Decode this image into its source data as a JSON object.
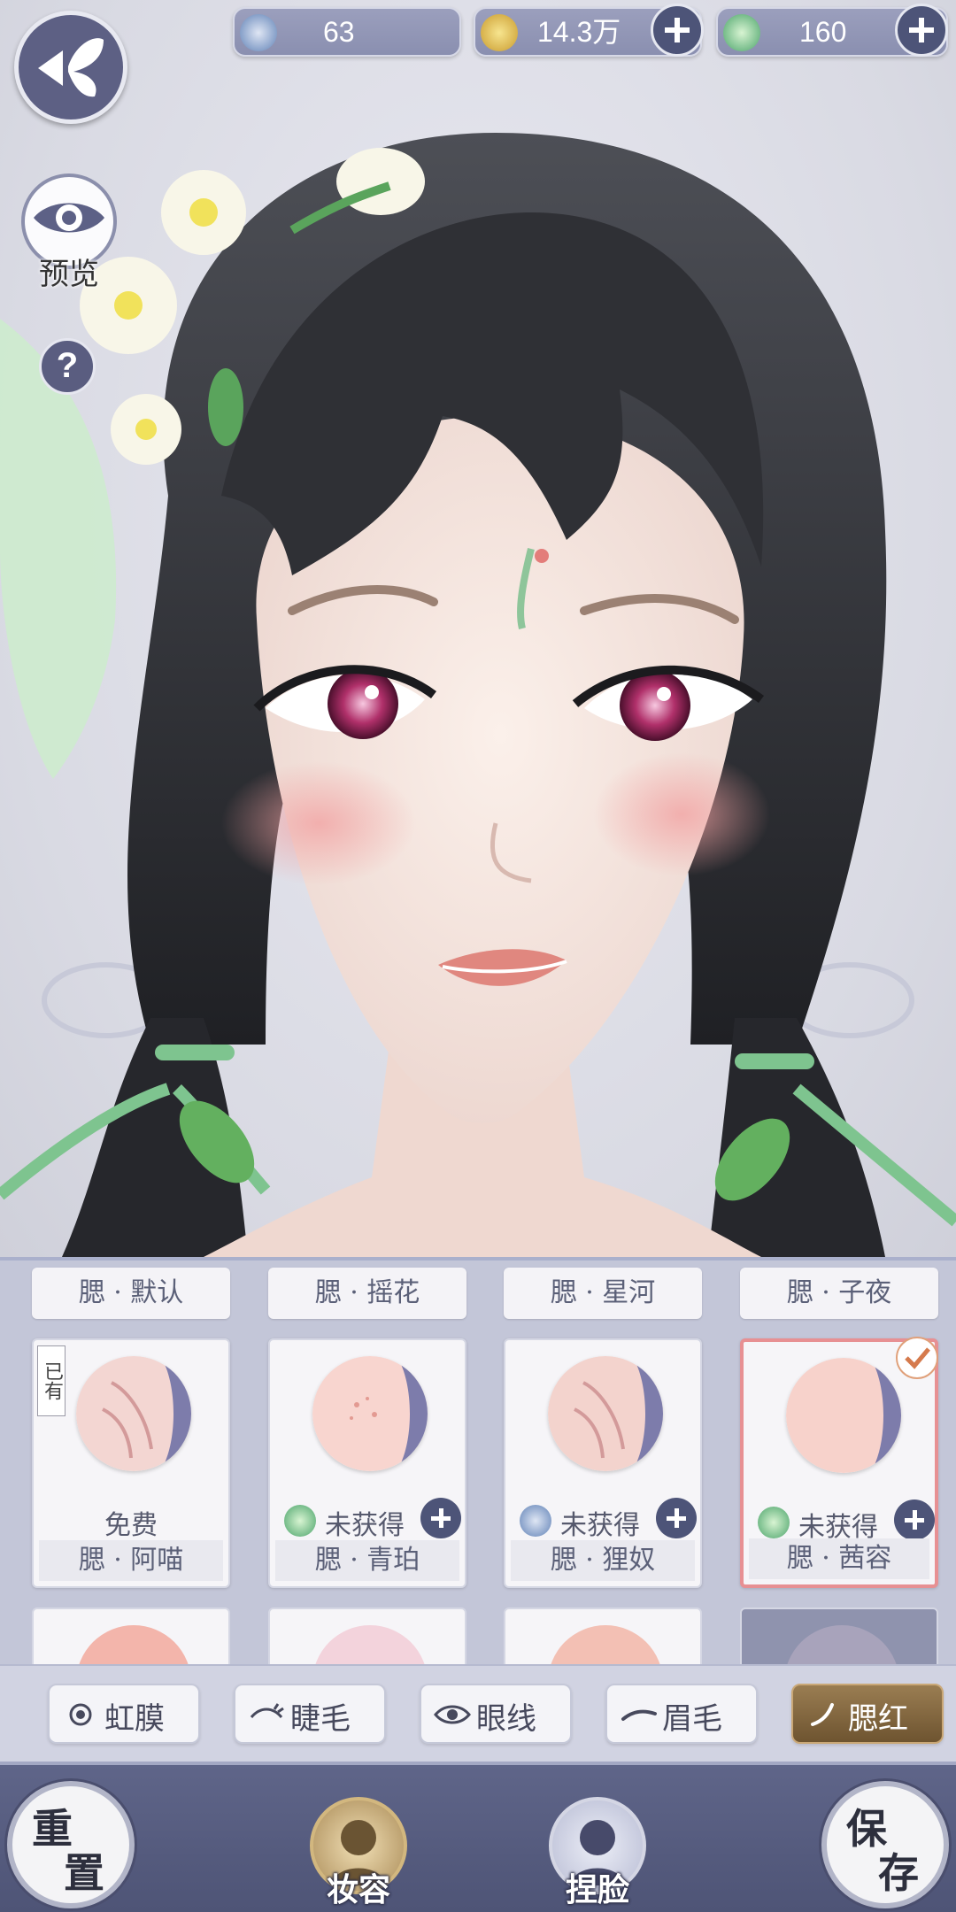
{
  "currency": {
    "silver": "63",
    "gold": "14.3万",
    "jade": "160"
  },
  "preview": {
    "eye_label": "预览",
    "help": "?"
  },
  "blush_headers": [
    "腮 · 默认",
    "腮 · 摇花",
    "腮 · 星河",
    "腮 · 子夜"
  ],
  "blush_cards": [
    {
      "name": "腮 · 阿喵",
      "status": "免费",
      "tag": "已有",
      "currency_icon": "none",
      "selected": false
    },
    {
      "name": "腮 · 青珀",
      "status": "未获得",
      "currency_icon": "jade-coin-icon",
      "selected": false
    },
    {
      "name": "腮 · 狸奴",
      "status": "未获得",
      "currency_icon": "silver-coin-icon",
      "selected": false
    },
    {
      "name": "腮 · 茜容",
      "status": "未获得",
      "currency_icon": "jade-coin-icon",
      "selected": true
    }
  ],
  "tabs": [
    {
      "label": "虹膜",
      "icon": "iris-icon",
      "active": false
    },
    {
      "label": "睫毛",
      "icon": "eyelash-icon",
      "active": false
    },
    {
      "label": "眼线",
      "icon": "eyeliner-icon",
      "active": false
    },
    {
      "label": "眉毛",
      "icon": "eyebrow-icon",
      "active": false
    },
    {
      "label": "腮红",
      "icon": "blush-icon",
      "active": true
    }
  ],
  "bottom": {
    "reset_1": "重",
    "reset_2": "置",
    "makeup": "妆容",
    "face": "捏脸",
    "save_1": "保",
    "save_2": "存"
  },
  "colors": {
    "accent_gold": "#8a6b42",
    "panel": "#c3c6d8",
    "bar": "#5f6589",
    "selected_border": "#e79093"
  }
}
